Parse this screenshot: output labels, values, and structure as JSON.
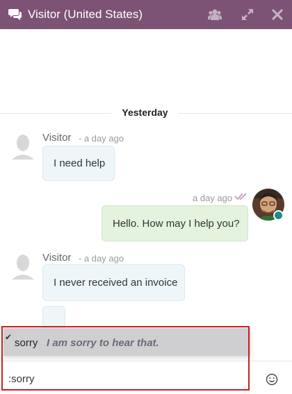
{
  "header": {
    "title": "Visitor (United States)",
    "icons": [
      "chat-icon",
      "users-icon",
      "expand-icon",
      "close-icon"
    ],
    "color": "#7c5275"
  },
  "thread": {
    "day_separator": "Yesterday",
    "messages": [
      {
        "author": "Visitor",
        "time": "- a day ago",
        "text": "I need help",
        "side": "visitor"
      },
      {
        "author": "",
        "time": "a day ago",
        "text": "Hello. How may I help you?",
        "side": "operator"
      },
      {
        "author": "Visitor",
        "time": "- a day ago",
        "text": "I never received an invoice",
        "side": "visitor"
      },
      {
        "author": "",
        "time": "",
        "text": "",
        "side": "visitor"
      }
    ]
  },
  "canned_response": {
    "key": "sorry",
    "text": "I am sorry to hear that.",
    "check_icon": "checkmark-icon"
  },
  "composer": {
    "value": ":sorry",
    "emoji_icon": "smiley-icon"
  },
  "colors": {
    "visitor_bubble": "#eef6f9",
    "operator_bubble": "#e3f3dd",
    "highlight_border": "#cc1f1f"
  }
}
